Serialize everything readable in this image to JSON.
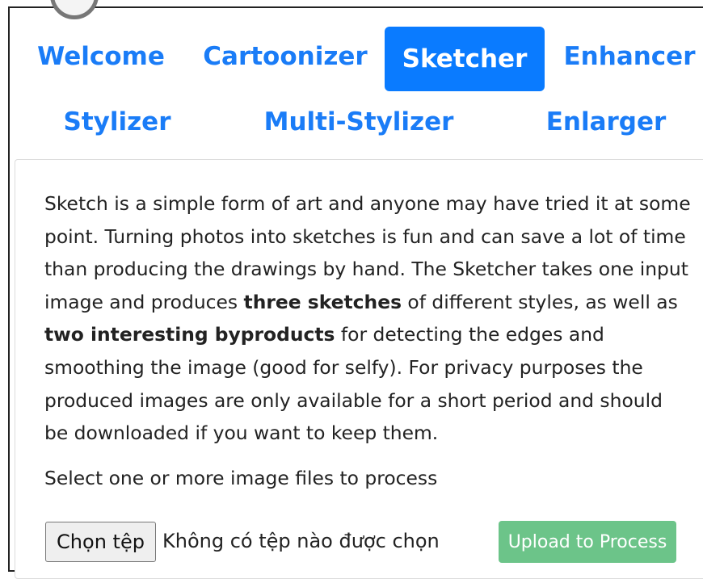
{
  "nav": {
    "tabs": [
      {
        "label": "Welcome",
        "active": false
      },
      {
        "label": "Cartoonizer",
        "active": false
      },
      {
        "label": "Sketcher",
        "active": true
      },
      {
        "label": "Enhancer",
        "active": false
      },
      {
        "label": "Stylizer",
        "active": false
      },
      {
        "label": "Multi-Stylizer",
        "active": false
      },
      {
        "label": "Enlarger",
        "active": false
      }
    ]
  },
  "content": {
    "desc_part1": "Sketch is a simple form of art and anyone may have tried it at some point. Turning photos into sketches is fun and can save a lot of time than producing the drawings by hand. The Sketcher takes one input image and produces ",
    "desc_bold1": "three sketches",
    "desc_part2": " of different styles, as well as ",
    "desc_bold2": "two interesting byproducts",
    "desc_part3": " for detecting the edges and smoothing the image (good for selfy). For privacy purposes the produced images are only available for a short period and should be downloaded if you want to keep them.",
    "select_label": "Select one or more image files to process"
  },
  "file_input": {
    "button_label": "Chọn tệp",
    "status": "Không có tệp nào được chọn"
  },
  "upload": {
    "label": "Upload to Process"
  },
  "colors": {
    "tab_text": "#1a7cf7",
    "tab_active_bg": "#0a7bff",
    "upload_bg": "#6cc489"
  }
}
